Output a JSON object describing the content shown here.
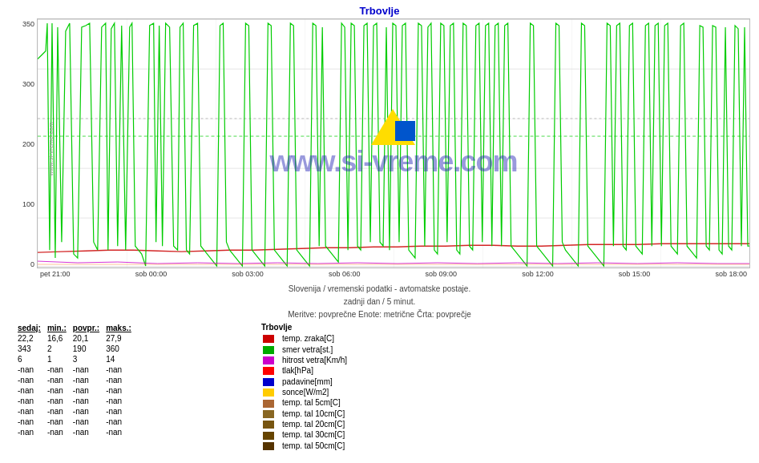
{
  "title": "Trbovlje",
  "watermark": "www.si-vreme.com",
  "si_vreme_side": "www.si-vreme.com",
  "subtitle_line1": "Slovenija / vremenski podatki - avtomatske postaje.",
  "subtitle_line2": "zadnji dan / 5 minut.",
  "subtitle_line3": "Meritve: povprečne  Enote: metrične  Črta: povprečje",
  "x_axis_labels": [
    "pet 21:00",
    "sob 00:00",
    "sob 03:00",
    "sob 06:00",
    "sob 09:00",
    "sob 12:00",
    "sob 15:00",
    "sob 18:00"
  ],
  "y_axis_labels": [
    "350",
    "300",
    "200",
    "100",
    "0"
  ],
  "stats": {
    "headers": [
      "sedaj:",
      "min.:",
      "povpr.:",
      "maks.:"
    ],
    "rows": [
      {
        "sedaj": "22,2",
        "min": "16,6",
        "povpr": "20,1",
        "maks": "27,9"
      },
      {
        "sedaj": "343",
        "min": "2",
        "povpr": "190",
        "maks": "360"
      },
      {
        "sedaj": "6",
        "min": "1",
        "povpr": "3",
        "maks": "14"
      },
      {
        "sedaj": "-nan",
        "min": "-nan",
        "povpr": "-nan",
        "maks": "-nan"
      },
      {
        "sedaj": "-nan",
        "min": "-nan",
        "povpr": "-nan",
        "maks": "-nan"
      },
      {
        "sedaj": "-nan",
        "min": "-nan",
        "povpr": "-nan",
        "maks": "-nan"
      },
      {
        "sedaj": "-nan",
        "min": "-nan",
        "povpr": "-nan",
        "maks": "-nan"
      },
      {
        "sedaj": "-nan",
        "min": "-nan",
        "povpr": "-nan",
        "maks": "-nan"
      },
      {
        "sedaj": "-nan",
        "min": "-nan",
        "povpr": "-nan",
        "maks": "-nan"
      },
      {
        "sedaj": "-nan",
        "min": "-nan",
        "povpr": "-nan",
        "maks": "-nan"
      }
    ]
  },
  "legend": [
    {
      "color": "#cc0000",
      "label": "temp. zraka[C]"
    },
    {
      "color": "#00aa00",
      "label": "smer vetra[st.]"
    },
    {
      "color": "#cc00cc",
      "label": "hitrost vetra[Km/h]"
    },
    {
      "color": "#ff0000",
      "label": "tlak[hPa]"
    },
    {
      "color": "#0000cc",
      "label": "padavine[mm]"
    },
    {
      "color": "#ffcc00",
      "label": "sonce[W/m2]"
    },
    {
      "color": "#aa6633",
      "label": "temp. tal  5cm[C]"
    },
    {
      "color": "#886622",
      "label": "temp. tal 10cm[C]"
    },
    {
      "color": "#775511",
      "label": "temp. tal 20cm[C]"
    },
    {
      "color": "#664400",
      "label": "temp. tal 30cm[C]"
    },
    {
      "color": "#553300",
      "label": "temp. tal 50cm[C]"
    }
  ]
}
